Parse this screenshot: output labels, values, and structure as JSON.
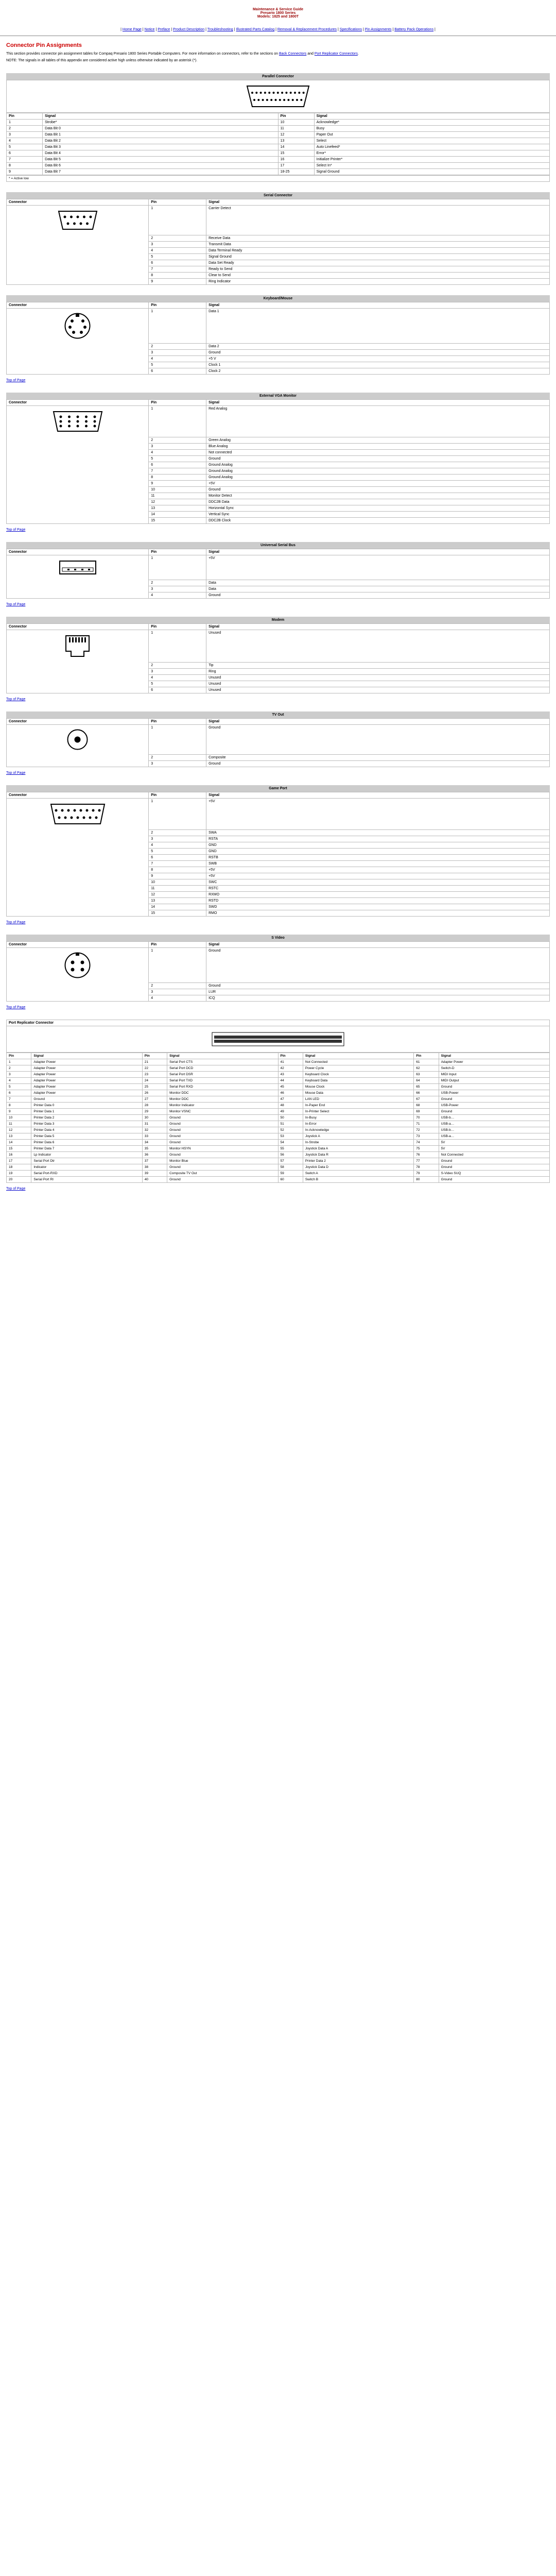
{
  "header": {
    "line1": "Maintenance & Service Guide",
    "line2": "Presario 1800 Series",
    "line3": "Models: 1825 and 1800T"
  },
  "nav": {
    "items": [
      "Home Page",
      "Notice",
      "Preface",
      "Product Description",
      "Troubleshooting",
      "Illustrated Parts Catalog",
      "Removal & Replacement Procedures",
      "Specifications",
      "Pin Assignments",
      "Battery Pack Operations"
    ]
  },
  "title": "Connector Pin Assignments",
  "intro": "This section provides connector pin assignment tables for Compaq Presario 1800 Series Portable Computers. For more information on connectors, refer to the sections on ",
  "intro_link1": "Back Connectors",
  "intro_mid": " and ",
  "intro_link2": "Port Replicator Connectors",
  "intro_end": ".",
  "note": "NOTE:   The signals in all tables of this appendix are considered active high unless otherwise indicated by an asterisk (*).",
  "top": "Top of Page",
  "pin_label": "Pin",
  "signal_label": "Signal",
  "connector_label": "Connector",
  "footnote_activelow": "* = Active low",
  "chart_data": [
    {
      "title": "Parallel Connector",
      "type": "table",
      "rows": [
        [
          "1",
          "Strobe*",
          "10",
          "Acknowledge*"
        ],
        [
          "2",
          "Data Bit 0",
          "11",
          "Busy"
        ],
        [
          "3",
          "Data Bit 1",
          "12",
          "Paper Out"
        ],
        [
          "4",
          "Data Bit 2",
          "13",
          "Select"
        ],
        [
          "5",
          "Data Bit 3",
          "14",
          "Auto Linefeed*"
        ],
        [
          "6",
          "Data Bit 4",
          "15",
          "Error*"
        ],
        [
          "7",
          "Data Bit 5",
          "16",
          "Initialize Printer*"
        ],
        [
          "8",
          "Data Bit 6",
          "17",
          "Select In*"
        ],
        [
          "9",
          "Data Bit 7",
          "18-25",
          "Signal Ground"
        ]
      ]
    },
    {
      "title": "Serial Connector",
      "type": "table",
      "rows": [
        [
          "1",
          "Carrier Detect"
        ],
        [
          "2",
          "Receive Data"
        ],
        [
          "3",
          "Transmit Data"
        ],
        [
          "4",
          "Data Terminal Ready"
        ],
        [
          "5",
          "Signal Ground"
        ],
        [
          "6",
          "Data Set Ready"
        ],
        [
          "7",
          "Ready to Send"
        ],
        [
          "8",
          "Clear to Send"
        ],
        [
          "9",
          "Ring Indicator"
        ]
      ]
    },
    {
      "title": "Keyboard/Mouse",
      "type": "table",
      "rows": [
        [
          "1",
          "Data 1"
        ],
        [
          "2",
          "Data 2"
        ],
        [
          "3",
          "Ground"
        ],
        [
          "4",
          "+5 V"
        ],
        [
          "5",
          "Clock 1"
        ],
        [
          "6",
          "Clock 2"
        ]
      ]
    },
    {
      "title": "External VGA Monitor",
      "type": "table",
      "rows": [
        [
          "1",
          "Red Analog"
        ],
        [
          "2",
          "Green Analog"
        ],
        [
          "3",
          "Blue Analog"
        ],
        [
          "4",
          "Not connected"
        ],
        [
          "5",
          "Ground"
        ],
        [
          "6",
          "Ground Analog"
        ],
        [
          "7",
          "Ground Analog"
        ],
        [
          "8",
          "Ground Analog"
        ],
        [
          "9",
          "+5V"
        ],
        [
          "10",
          "Ground"
        ],
        [
          "11",
          "Monitor Detect"
        ],
        [
          "12",
          "DDC2B Data"
        ],
        [
          "13",
          "Horizontal Sync"
        ],
        [
          "14",
          "Vertical Sync"
        ],
        [
          "15",
          "DDC2B Clock"
        ]
      ]
    },
    {
      "title": "Universal Serial Bus",
      "type": "table",
      "rows": [
        [
          "1",
          "+5V"
        ],
        [
          "2",
          "Data"
        ],
        [
          "3",
          "Data"
        ],
        [
          "4",
          "Ground"
        ]
      ]
    },
    {
      "title": "Modem",
      "type": "table",
      "rows": [
        [
          "1",
          "Unused"
        ],
        [
          "2",
          "Tip"
        ],
        [
          "3",
          "Ring"
        ],
        [
          "4",
          "Unused"
        ],
        [
          "5",
          "Unused"
        ],
        [
          "6",
          "Unused"
        ]
      ]
    },
    {
      "title": "TV Out",
      "type": "table",
      "rows": [
        [
          "1",
          "Ground"
        ],
        [
          "2",
          "Composite"
        ],
        [
          "3",
          "Ground"
        ]
      ]
    },
    {
      "title": "Game Port",
      "type": "table",
      "rows": [
        [
          "1",
          "+5V"
        ],
        [
          "2",
          "SWA"
        ],
        [
          "3",
          "RSTA"
        ],
        [
          "4",
          "GND"
        ],
        [
          "5",
          "GND"
        ],
        [
          "6",
          "RSTB"
        ],
        [
          "7",
          "SWB"
        ],
        [
          "8",
          "+5V"
        ],
        [
          "9",
          "+5V"
        ],
        [
          "10",
          "SWC"
        ],
        [
          "11",
          "RSTC"
        ],
        [
          "12",
          "RXMO"
        ],
        [
          "13",
          "RSTD"
        ],
        [
          "14",
          "SWD"
        ],
        [
          "15",
          "RMO"
        ]
      ]
    },
    {
      "title": "S Video",
      "type": "table",
      "rows": [
        [
          "1",
          "Ground"
        ],
        [
          "2",
          "Ground"
        ],
        [
          "3",
          "LUR"
        ],
        [
          "4",
          "ICQ"
        ]
      ]
    }
  ],
  "port_replicator": {
    "title": "Port Replicator Connector",
    "rows": [
      [
        "1",
        "Adapter Power",
        "21",
        "Serial Port CTS",
        "41",
        "Not Connected",
        "61",
        "Adapter Power"
      ],
      [
        "2",
        "Adapter Power",
        "22",
        "Serial Port DCD",
        "42",
        "Power Cycle",
        "62",
        "Switch-D"
      ],
      [
        "3",
        "Adapter Power",
        "23",
        "Serial Port DSR",
        "43",
        "Keyboard Clock",
        "63",
        "MIDI Input"
      ],
      [
        "4",
        "Adapter Power",
        "24",
        "Serial Port TXD",
        "44",
        "Keyboard Data",
        "64",
        "MIDI Output"
      ],
      [
        "5",
        "Adapter Power",
        "25",
        "Serial Port RXD",
        "45",
        "Mouse Clock",
        "65",
        "Ground"
      ],
      [
        "6",
        "Adapter Power",
        "26",
        "Monitor DDC",
        "46",
        "Mouse Data",
        "66",
        "USB-Power"
      ],
      [
        "7",
        "Ground",
        "27",
        "Monitor DDC",
        "47",
        "LAN LED",
        "67",
        "Ground"
      ],
      [
        "8",
        "Printer Data 0",
        "28",
        "Monitor Indicator",
        "48",
        "In-Paper End",
        "68",
        "USB-Power"
      ],
      [
        "9",
        "Printer Data 1",
        "29",
        "Monitor VSNC",
        "49",
        "In-Printer Select",
        "69",
        "Ground"
      ],
      [
        "10",
        "Printer Data 2",
        "30",
        "Ground",
        "50",
        "In-Busy",
        "70",
        "USB-b…"
      ],
      [
        "11",
        "Printer Data 3",
        "31",
        "Ground",
        "51",
        "In-Error",
        "71",
        "USB-a…"
      ],
      [
        "12",
        "Printer Data 4",
        "32",
        "Ground",
        "52",
        "In-Acknowledge",
        "72",
        "USB-b…"
      ],
      [
        "13",
        "Printer Data 5",
        "33",
        "Ground",
        "53",
        "Joystick A",
        "73",
        "USB-a…"
      ],
      [
        "14",
        "Printer Data 6",
        "34",
        "Ground",
        "54",
        "In-Strobe",
        "74",
        "5V"
      ],
      [
        "15",
        "Printer Data 7",
        "35",
        "Monitor HSYN",
        "55",
        "Joystick Data A",
        "75",
        "5V"
      ],
      [
        "16",
        "Lp Indicator",
        "36",
        "Ground",
        "56",
        "Joystick Data R",
        "76",
        "Not Connected"
      ],
      [
        "17",
        "Serial Port Dtr",
        "37",
        "Monitor Blue",
        "57",
        "Printer Data 2",
        "77",
        "Ground"
      ],
      [
        "18",
        "Indicator",
        "38",
        "Ground",
        "58",
        "Joystick Data D",
        "78",
        "Ground"
      ],
      [
        "19",
        "Serial Port-RXD",
        "39",
        "Composite TV Out",
        "59",
        "Switch A",
        "79",
        "S-Video SUQ"
      ],
      [
        "20",
        "Serial Port RI",
        "40",
        "Ground",
        "60",
        "Switch B",
        "80",
        "Ground"
      ]
    ]
  }
}
